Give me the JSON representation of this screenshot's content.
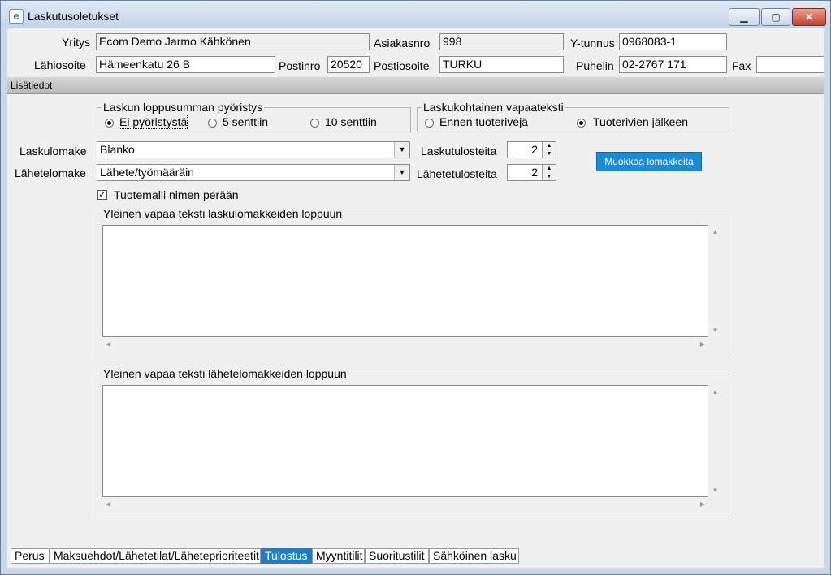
{
  "window": {
    "title": "Laskutusoletukset",
    "app_icon": "e-icon"
  },
  "header": {
    "yritys_label": "Yritys",
    "yritys_value": "Ecom Demo Jarmo Kähkönen",
    "asiakasnro_label": "Asiakasnro",
    "asiakasnro_value": "998",
    "ytunnus_label": "Y-tunnus",
    "ytunnus_value": "0968083-1",
    "lahiosoite_label": "Lähiosoite",
    "lahiosoite_value": "Hämeenkatu 26 B",
    "postinro_label": "Postinro",
    "postinro_value": "20520",
    "postiosoite_label": "Postiosoite",
    "postiosoite_value": "TURKU",
    "puhelin_label": "Puhelin",
    "puhelin_value": "02-2767 171",
    "fax_label": "Fax",
    "fax_value": ""
  },
  "section": {
    "title": "Lisätiedot"
  },
  "rounding": {
    "legend": "Laskun loppusumman pyöristys",
    "options": [
      "Ei pyöristystä",
      "5 senttiin",
      "10 senttiin"
    ],
    "selected": "Ei pyöristystä"
  },
  "freetext_position": {
    "legend": "Laskukohtainen vapaateksti",
    "options": [
      "Ennen tuoterivejä",
      "Tuoterivien jälkeen"
    ],
    "selected": "Tuoterivien jälkeen"
  },
  "forms": {
    "laskulomake_label": "Laskulomake",
    "laskulomake_value": "Blanko",
    "lahetelomake_label": "Lähetelomake",
    "lahetelomake_value": "Lähete/työmääräin",
    "laskutulosteita_label": "Laskutulosteita",
    "laskutulosteita_value": "2",
    "lahetetulosteita_label": "Lähetetulosteita",
    "lahetetulosteita_value": "2",
    "edit_button": "Muokkaa lomakkeita"
  },
  "tuotemalli": {
    "label": "Tuotemalli nimen perään",
    "checked": true
  },
  "invoice_text": {
    "legend": "Yleinen vapaa teksti laskulomakkeiden loppuun",
    "value": ""
  },
  "delivery_text": {
    "legend": "Yleinen vapaa teksti lähetelomakkeiden loppuun",
    "value": ""
  },
  "tabs": [
    "Perus",
    "Maksuehdot/Lähetetilat/Läheteprioriteetit",
    "Tulostus",
    "Myyntitilit",
    "Suoritustilit",
    "Sähköinen lasku"
  ],
  "active_tab": "Tulostus",
  "colors": {
    "accent": "#1a8bd4",
    "active_tab": "#1a7fc6"
  }
}
